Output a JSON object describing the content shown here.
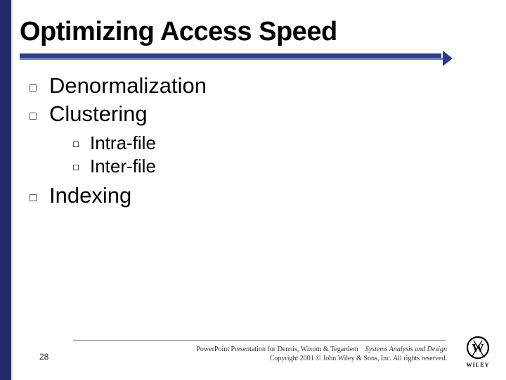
{
  "title": "Optimizing Access Speed",
  "bullets": {
    "items": [
      {
        "text": "Denormalization"
      },
      {
        "text": "Clustering"
      },
      {
        "text": "Indexing"
      }
    ],
    "sub_after_clustering": [
      {
        "text": "Intra-file"
      },
      {
        "text": "Inter-file"
      }
    ]
  },
  "footer": {
    "page_number": "28",
    "line1_prefix": "PowerPoint Presentation for Dennis, Wixom & Tegardem",
    "line1_suffix": "Systems Analysis and Design",
    "line2": "Copyright 2001 © John Wiley & Sons, Inc.  All rights reserved."
  },
  "logo_name": "WILEY"
}
